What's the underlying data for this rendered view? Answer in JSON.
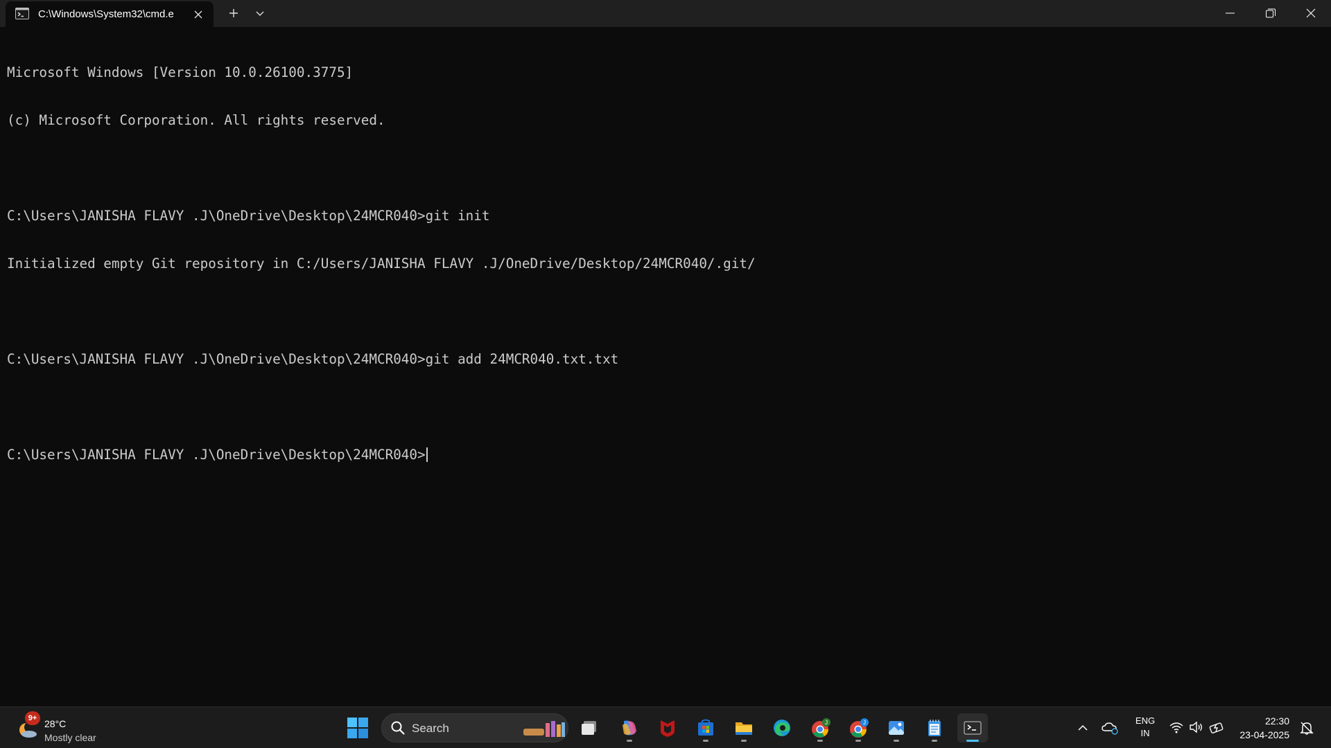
{
  "window": {
    "tab_title": "C:\\Windows\\System32\\cmd.e",
    "icons": {
      "tab": "terminal-icon",
      "close_tab": "close-icon",
      "new_tab": "plus-icon",
      "dropdown": "chevron-down-icon",
      "minimize": "minimize-icon",
      "maximize": "restore-icon",
      "close": "close-icon"
    }
  },
  "terminal": {
    "lines": [
      "Microsoft Windows [Version 10.0.26100.3775]",
      "(c) Microsoft Corporation. All rights reserved.",
      "",
      "C:\\Users\\JANISHA FLAVY .J\\OneDrive\\Desktop\\24MCR040>git init",
      "Initialized empty Git repository in C:/Users/JANISHA FLAVY .J/OneDrive/Desktop/24MCR040/.git/",
      "",
      "C:\\Users\\JANISHA FLAVY .J\\OneDrive\\Desktop\\24MCR040>git add 24MCR040.txt.txt",
      ""
    ],
    "prompt": "C:\\Users\\JANISHA FLAVY .J\\OneDrive\\Desktop\\24MCR040>",
    "text_color": "#cccccc",
    "background": "#0c0c0c"
  },
  "taskbar": {
    "weather": {
      "badge": "9+",
      "temp": "28°C",
      "condition": "Mostly clear"
    },
    "search_label": "Search",
    "apps": [
      "task-view-icon",
      "copilot-icon",
      "mcafee-icon",
      "microsoft-store-icon",
      "file-explorer-icon",
      "edge-icon",
      "chrome-profile-j-icon",
      "chrome-profile-2-icon",
      "photos-icon",
      "notepad-icon",
      "terminal-icon"
    ],
    "tray": {
      "language": "ENG",
      "region": "IN",
      "time": "22:30",
      "date": "23-04-2025"
    }
  },
  "colors": {
    "titlebar": "#202020",
    "taskbar": "#1c1c1c",
    "accent": "#4cc2ff"
  }
}
